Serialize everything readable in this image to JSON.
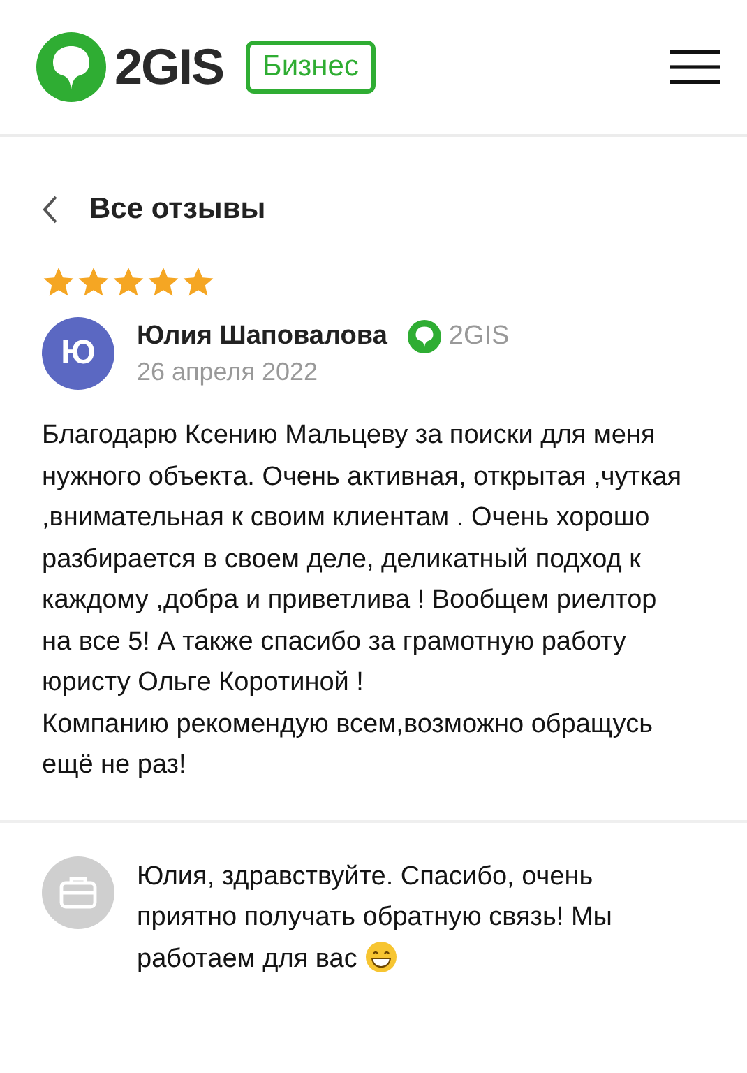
{
  "header": {
    "logo_text": "2GIS",
    "badge": "Бизнес"
  },
  "nav": {
    "title": "Все отзывы"
  },
  "review": {
    "stars": 5,
    "avatar_letter": "Ю",
    "author": "Юлия Шаповалова",
    "source": "2GIS",
    "date": "26 апреля 2022",
    "text": "Благодарю Ксению Мальцеву за поиски для меня нужного объекта. Очень активная, открытая ,чуткая ,внимательная к своим клиентам . Очень хорошо разбирается в своем деле, деликатный подход к каждому ,добра и приветлива ! Вообщем риелтор на все 5! А также спасибо за грамотную работу юристу Ольге Коротиной !\nКомпанию рекомендую всем,возможно обращусь ещё не раз!"
  },
  "reply": {
    "text": "Юлия, здравствуйте. Спасибо, очень приятно получать обратную связь! Мы работаем для вас"
  }
}
